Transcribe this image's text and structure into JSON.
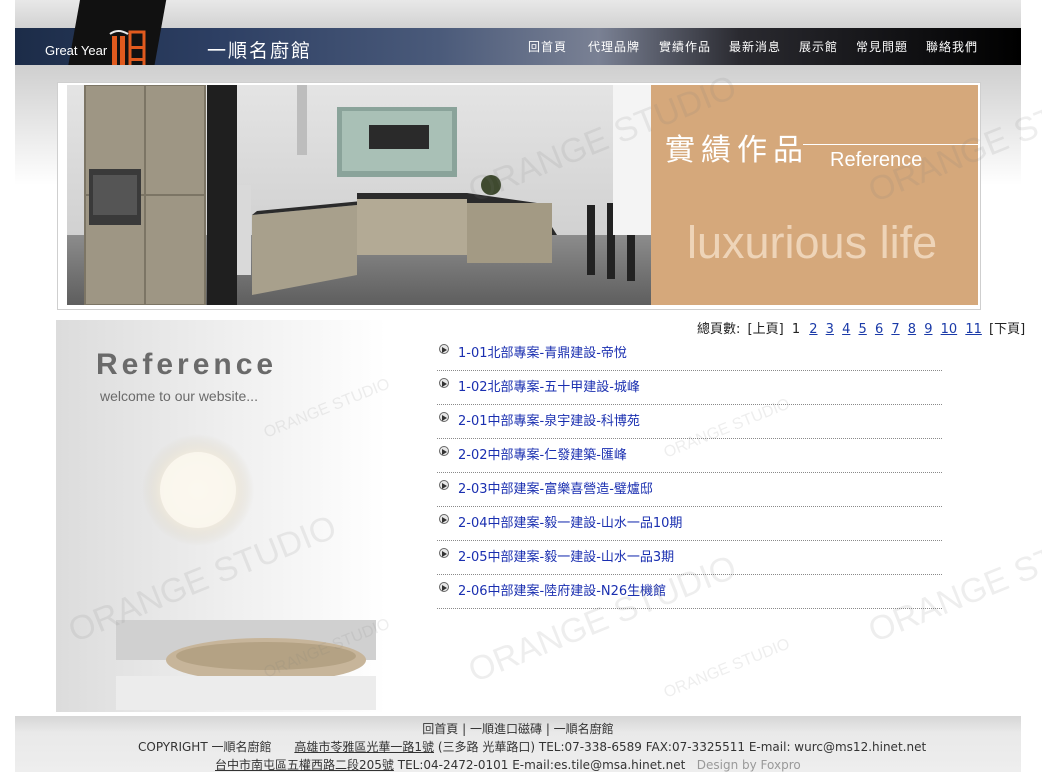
{
  "site": {
    "brand_en": "Great Year",
    "brand_zh": "一順名廚館"
  },
  "nav": {
    "items": [
      {
        "label": "回首頁"
      },
      {
        "label": "代理品牌"
      },
      {
        "label": "實績作品"
      },
      {
        "label": "最新消息"
      },
      {
        "label": "展示館"
      },
      {
        "label": "常見問題"
      },
      {
        "label": "聯絡我們"
      }
    ]
  },
  "banner": {
    "title_zh": "實績作品",
    "title_en": "Reference",
    "tagline": "luxurious life"
  },
  "side": {
    "title": "Reference",
    "subtitle": "welcome to our website..."
  },
  "pager": {
    "label": "總頁數:",
    "prev": "[上頁]",
    "current": "1",
    "pages": [
      "2",
      "3",
      "4",
      "5",
      "6",
      "7",
      "8",
      "9",
      "10",
      "11"
    ],
    "next": "[下頁]"
  },
  "projects": [
    "1-01北部專案-青鼎建設-帝悅",
    "1-02北部專案-五十甲建設-城峰",
    "2-01中部專案-泉宇建設-科博苑",
    "2-02中部專案-仁發建築-匯峰",
    "2-03中部建案-富樂喜營造-璧爐邸",
    "2-04中部建案-毅一建設-山水一品10期",
    "2-05中部建案-毅一建設-山水一品3期",
    "2-06中部建案-陸府建設-N26生機館"
  ],
  "footer": {
    "links": [
      "回首頁",
      "一順進口磁磚",
      "一順名廚館"
    ],
    "copyright": "COPYRIGHT 一順名廚館",
    "address1": "高雄市苓雅區光華一路1號",
    "address1_note": "(三多路 光華路口)",
    "contact1": "TEL:07-338-6589   FAX:07-3325511 E-mail:  wurc@ms12.hinet.net",
    "address2": "台中市南屯區五權西路二段205號",
    "contact2": "TEL:04-2472-0101  E-mail:es.tile@msa.hinet.net",
    "design": "Design by Foxpro"
  },
  "watermark": "ORANGE STUDIO",
  "colors": {
    "header_dark": "#1c2c48",
    "banner_tan": "#d5a87b",
    "link_blue": "#1a2fb0"
  }
}
